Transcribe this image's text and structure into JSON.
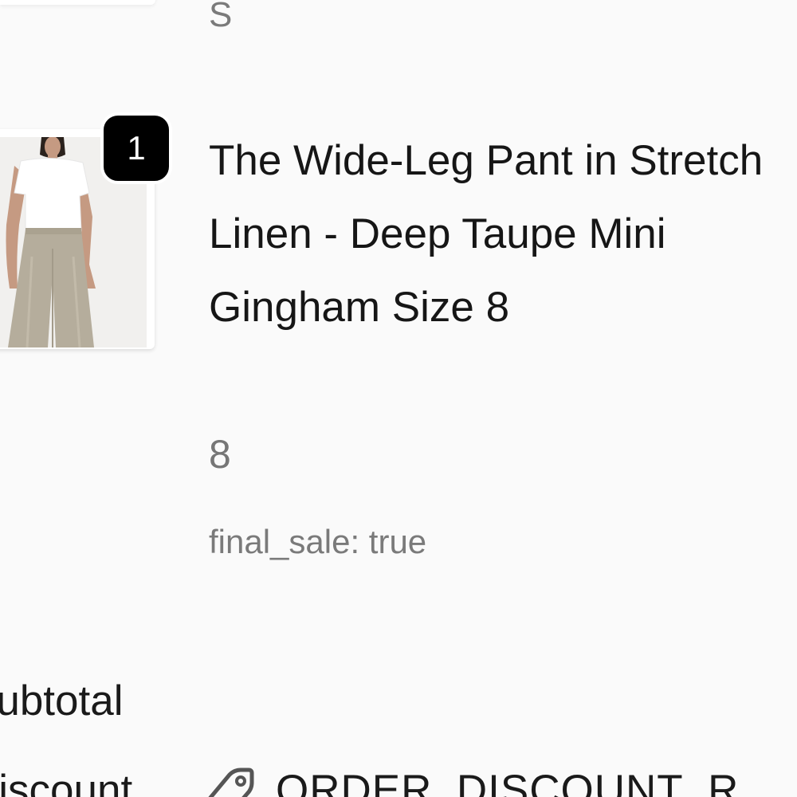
{
  "previous_item": {
    "variant": "S"
  },
  "line_item": {
    "quantity": "1",
    "title": "The Wide-Leg Pant in Stretch Linen - Deep Taupe Mini Gingham Size 8",
    "variant": "8",
    "property": "final_sale: true",
    "thumbnail_icon": "product-photo-icon"
  },
  "summary": {
    "subtotal_label": "Subtotal",
    "discount_label": "Discount",
    "discount_code": "ORDER_DISCOUNT_R",
    "discount_icon": "tag-icon"
  },
  "colors": {
    "badge_bg": "#000000",
    "text_primary": "#161616",
    "text_secondary": "#767676",
    "background": "#fafafa"
  }
}
